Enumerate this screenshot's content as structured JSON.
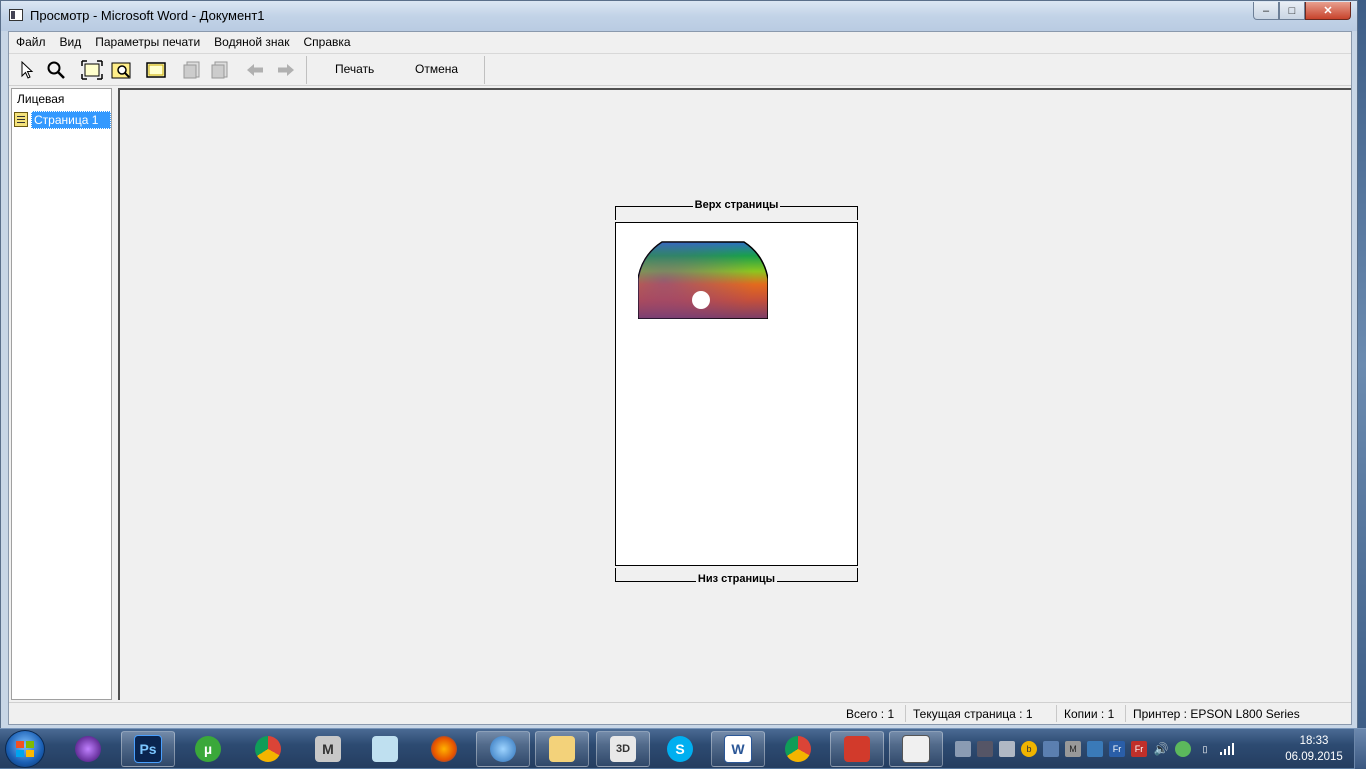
{
  "window": {
    "title": "Просмотр - Microsoft Word - Документ1",
    "minimize": "–",
    "maximize": "□",
    "close": "✕"
  },
  "menu": [
    "Файл",
    "Вид",
    "Параметры печати",
    "Водяной знак",
    "Справка"
  ],
  "toolbar": {
    "icons": [
      "pointer-icon",
      "zoom-icon",
      "fit-page-icon",
      "zoom-window-icon",
      "page-frame-icon",
      "prev-page-icon",
      "next-page-icon",
      "back-arrow-icon",
      "forward-arrow-icon"
    ],
    "print_label": "Печать",
    "cancel_label": "Отмена"
  },
  "sidebar": {
    "root": "Лицевая",
    "pages": [
      "Страница 1"
    ]
  },
  "preview": {
    "top_label": "Верх страницы",
    "bottom_label": "Низ страницы"
  },
  "status": {
    "total": "Всего : 1",
    "current_page": "Текущая страница : 1",
    "copies": "Копии : 1",
    "printer": "Принтер : EPSON L800 Series"
  },
  "taskbar": {
    "apps": [
      "start-button",
      "media-player",
      "photoshop",
      "utorrent",
      "chrome",
      "app-m",
      "notepad",
      "firefox",
      "network-app",
      "explorer",
      "video-editor",
      "skype",
      "word",
      "chrome-2",
      "pdf-app",
      "preview-app"
    ],
    "clock_time": "18:33",
    "clock_date": "06.09.2015"
  },
  "colors": {
    "selection": "#3399ff",
    "client_bg": "#f0f0f0",
    "taskbar": "#2d4b72"
  }
}
